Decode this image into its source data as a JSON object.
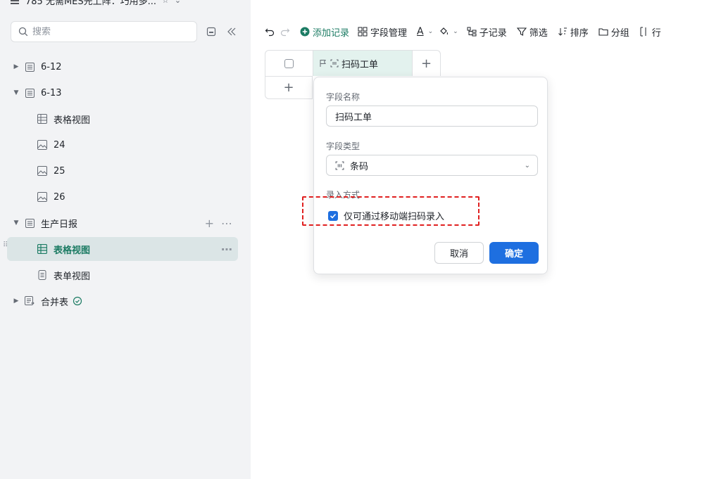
{
  "app": {
    "title": "785 无需MES先上阵：巧用多...",
    "star_icon": "star-icon",
    "caret_icon": "chevron-down-icon"
  },
  "sidebar": {
    "search_placeholder": "搜索",
    "items": [
      {
        "label": "6-12",
        "icon": "table-icon",
        "expanded": false
      },
      {
        "label": "6-13",
        "icon": "table-icon",
        "expanded": true
      },
      {
        "label": "表格视图",
        "icon": "grid-view-icon"
      },
      {
        "label": "24",
        "icon": "gallery-icon"
      },
      {
        "label": "25",
        "icon": "gallery-icon"
      },
      {
        "label": "26",
        "icon": "gallery-icon"
      },
      {
        "label": "生产日报",
        "icon": "table-icon",
        "expanded": true
      },
      {
        "label": "表格视图",
        "icon": "grid-view-icon",
        "active": true
      },
      {
        "label": "表单视图",
        "icon": "form-view-icon"
      },
      {
        "label": "合并表",
        "icon": "merged-table-icon",
        "expanded": false
      }
    ]
  },
  "toolbar": {
    "add_record": "添加记录",
    "field_manage": "字段管理",
    "sub_record": "子记录",
    "filter": "筛选",
    "sort": "排序",
    "group": "分组",
    "row_height": "行"
  },
  "grid": {
    "field_name": "扫码工单"
  },
  "popup": {
    "name_label": "字段名称",
    "name_value": "扫码工单",
    "type_label": "字段类型",
    "type_value": "条码",
    "input_label": "录入方式",
    "checkbox_label": "仅可通过移动端扫码录入",
    "checkbox_checked": true,
    "cancel": "取消",
    "confirm": "确定"
  },
  "colors": {
    "accent_green": "#1b7b63",
    "primary_blue": "#1e6fe0",
    "highlight_red": "#e02020"
  }
}
